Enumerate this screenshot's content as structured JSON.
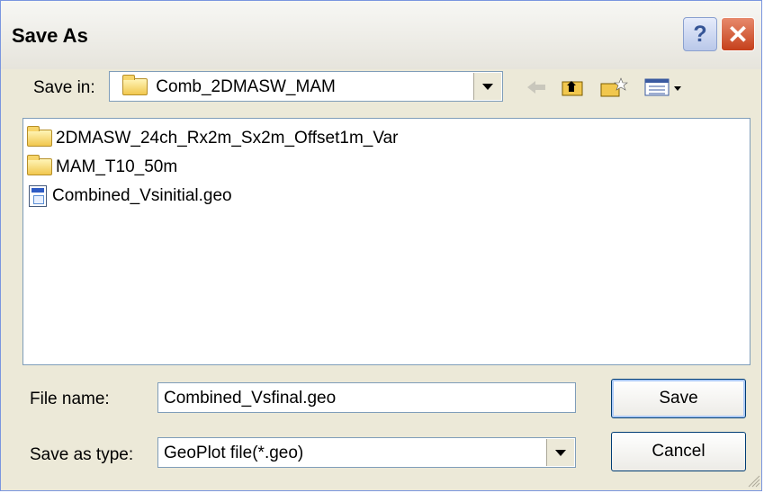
{
  "dialog": {
    "title": "Save As",
    "help_glyph": "?",
    "close_glyph": "✕"
  },
  "save_in": {
    "label": "Save in:",
    "value": "Comb_2DMASW_MAM"
  },
  "toolbar": {
    "icons": [
      "back-arrow-icon",
      "up-one-level-icon",
      "create-new-folder-icon",
      "view-menu-icon"
    ]
  },
  "files": [
    {
      "name": "2DMASW_24ch_Rx2m_Sx2m_Offset1m_Var",
      "type": "folder"
    },
    {
      "name": "MAM_T10_50m",
      "type": "folder"
    },
    {
      "name": "Combined_Vsinitial.geo",
      "type": "file"
    }
  ],
  "file_name": {
    "label": "File name:",
    "value": "Combined_Vsfinal.geo"
  },
  "save_as_type": {
    "label": "Save as type:",
    "value": "GeoPlot file(*.geo)"
  },
  "buttons": {
    "save": "Save",
    "cancel": "Cancel"
  },
  "colors": {
    "window_bg": "#ece9d8",
    "close_red": "#c5401b",
    "folder_yellow": "#f1c74e"
  }
}
